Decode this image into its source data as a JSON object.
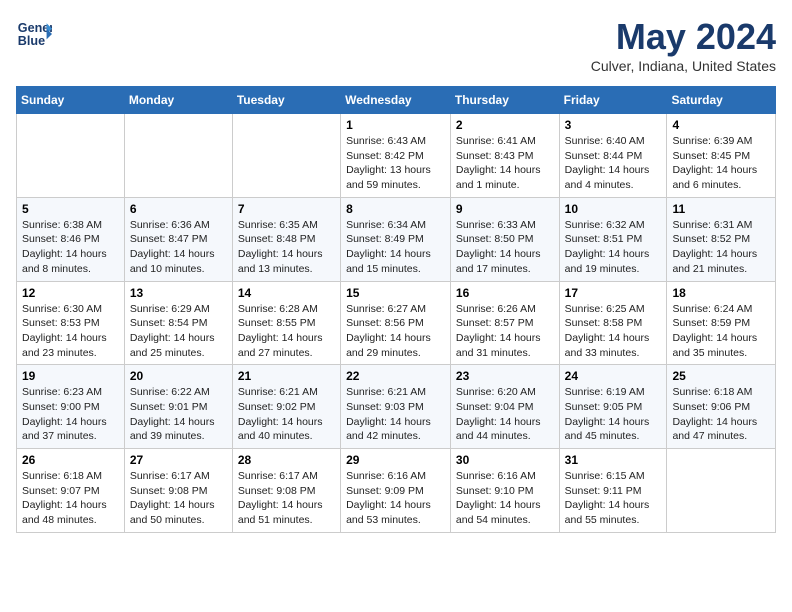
{
  "header": {
    "logo_line1": "General",
    "logo_line2": "Blue",
    "month": "May 2024",
    "location": "Culver, Indiana, United States"
  },
  "weekdays": [
    "Sunday",
    "Monday",
    "Tuesday",
    "Wednesday",
    "Thursday",
    "Friday",
    "Saturday"
  ],
  "weeks": [
    [
      {
        "day": "",
        "info": ""
      },
      {
        "day": "",
        "info": ""
      },
      {
        "day": "",
        "info": ""
      },
      {
        "day": "1",
        "info": "Sunrise: 6:43 AM\nSunset: 8:42 PM\nDaylight: 13 hours and 59 minutes."
      },
      {
        "day": "2",
        "info": "Sunrise: 6:41 AM\nSunset: 8:43 PM\nDaylight: 14 hours and 1 minute."
      },
      {
        "day": "3",
        "info": "Sunrise: 6:40 AM\nSunset: 8:44 PM\nDaylight: 14 hours and 4 minutes."
      },
      {
        "day": "4",
        "info": "Sunrise: 6:39 AM\nSunset: 8:45 PM\nDaylight: 14 hours and 6 minutes."
      }
    ],
    [
      {
        "day": "5",
        "info": "Sunrise: 6:38 AM\nSunset: 8:46 PM\nDaylight: 14 hours and 8 minutes."
      },
      {
        "day": "6",
        "info": "Sunrise: 6:36 AM\nSunset: 8:47 PM\nDaylight: 14 hours and 10 minutes."
      },
      {
        "day": "7",
        "info": "Sunrise: 6:35 AM\nSunset: 8:48 PM\nDaylight: 14 hours and 13 minutes."
      },
      {
        "day": "8",
        "info": "Sunrise: 6:34 AM\nSunset: 8:49 PM\nDaylight: 14 hours and 15 minutes."
      },
      {
        "day": "9",
        "info": "Sunrise: 6:33 AM\nSunset: 8:50 PM\nDaylight: 14 hours and 17 minutes."
      },
      {
        "day": "10",
        "info": "Sunrise: 6:32 AM\nSunset: 8:51 PM\nDaylight: 14 hours and 19 minutes."
      },
      {
        "day": "11",
        "info": "Sunrise: 6:31 AM\nSunset: 8:52 PM\nDaylight: 14 hours and 21 minutes."
      }
    ],
    [
      {
        "day": "12",
        "info": "Sunrise: 6:30 AM\nSunset: 8:53 PM\nDaylight: 14 hours and 23 minutes."
      },
      {
        "day": "13",
        "info": "Sunrise: 6:29 AM\nSunset: 8:54 PM\nDaylight: 14 hours and 25 minutes."
      },
      {
        "day": "14",
        "info": "Sunrise: 6:28 AM\nSunset: 8:55 PM\nDaylight: 14 hours and 27 minutes."
      },
      {
        "day": "15",
        "info": "Sunrise: 6:27 AM\nSunset: 8:56 PM\nDaylight: 14 hours and 29 minutes."
      },
      {
        "day": "16",
        "info": "Sunrise: 6:26 AM\nSunset: 8:57 PM\nDaylight: 14 hours and 31 minutes."
      },
      {
        "day": "17",
        "info": "Sunrise: 6:25 AM\nSunset: 8:58 PM\nDaylight: 14 hours and 33 minutes."
      },
      {
        "day": "18",
        "info": "Sunrise: 6:24 AM\nSunset: 8:59 PM\nDaylight: 14 hours and 35 minutes."
      }
    ],
    [
      {
        "day": "19",
        "info": "Sunrise: 6:23 AM\nSunset: 9:00 PM\nDaylight: 14 hours and 37 minutes."
      },
      {
        "day": "20",
        "info": "Sunrise: 6:22 AM\nSunset: 9:01 PM\nDaylight: 14 hours and 39 minutes."
      },
      {
        "day": "21",
        "info": "Sunrise: 6:21 AM\nSunset: 9:02 PM\nDaylight: 14 hours and 40 minutes."
      },
      {
        "day": "22",
        "info": "Sunrise: 6:21 AM\nSunset: 9:03 PM\nDaylight: 14 hours and 42 minutes."
      },
      {
        "day": "23",
        "info": "Sunrise: 6:20 AM\nSunset: 9:04 PM\nDaylight: 14 hours and 44 minutes."
      },
      {
        "day": "24",
        "info": "Sunrise: 6:19 AM\nSunset: 9:05 PM\nDaylight: 14 hours and 45 minutes."
      },
      {
        "day": "25",
        "info": "Sunrise: 6:18 AM\nSunset: 9:06 PM\nDaylight: 14 hours and 47 minutes."
      }
    ],
    [
      {
        "day": "26",
        "info": "Sunrise: 6:18 AM\nSunset: 9:07 PM\nDaylight: 14 hours and 48 minutes."
      },
      {
        "day": "27",
        "info": "Sunrise: 6:17 AM\nSunset: 9:08 PM\nDaylight: 14 hours and 50 minutes."
      },
      {
        "day": "28",
        "info": "Sunrise: 6:17 AM\nSunset: 9:08 PM\nDaylight: 14 hours and 51 minutes."
      },
      {
        "day": "29",
        "info": "Sunrise: 6:16 AM\nSunset: 9:09 PM\nDaylight: 14 hours and 53 minutes."
      },
      {
        "day": "30",
        "info": "Sunrise: 6:16 AM\nSunset: 9:10 PM\nDaylight: 14 hours and 54 minutes."
      },
      {
        "day": "31",
        "info": "Sunrise: 6:15 AM\nSunset: 9:11 PM\nDaylight: 14 hours and 55 minutes."
      },
      {
        "day": "",
        "info": ""
      }
    ]
  ]
}
